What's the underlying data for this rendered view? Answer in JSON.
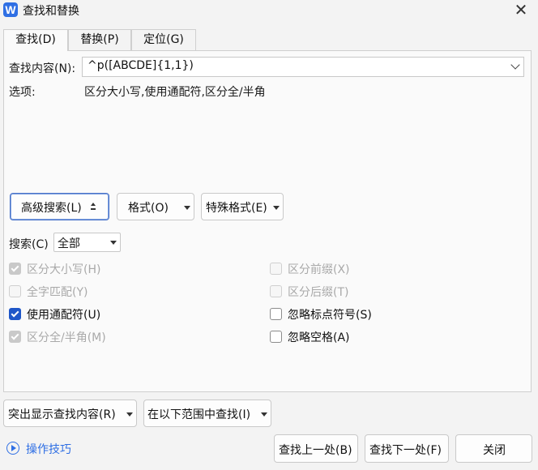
{
  "window": {
    "title": "查找和替换",
    "app_icon_letter": "W",
    "close_glyph": "✕"
  },
  "tabs": [
    {
      "label": "查找(D)",
      "active": true
    },
    {
      "label": "替换(P)",
      "active": false
    },
    {
      "label": "定位(G)",
      "active": false
    }
  ],
  "find": {
    "label": "查找内容(N):",
    "value": "^p([ABCDE]{1,1})"
  },
  "options": {
    "label": "选项:",
    "value": "区分大小写,使用通配符,区分全/半角"
  },
  "buttons": {
    "advanced": "高级搜索(L)",
    "format": "格式(O)",
    "special": "特殊格式(E)",
    "highlight": "突出显示查找内容(R)",
    "find_in": "在以下范围中查找(I)",
    "find_prev": "查找上一处(B)",
    "find_next": "查找下一处(F)",
    "close": "关闭"
  },
  "search_scope": {
    "label": "搜索(C)",
    "value": "全部"
  },
  "checkboxes": {
    "left": [
      {
        "label": "区分大小写(H)",
        "checked": true,
        "enabled": false
      },
      {
        "label": "全字匹配(Y)",
        "checked": false,
        "enabled": false
      },
      {
        "label": "使用通配符(U)",
        "checked": true,
        "enabled": true
      },
      {
        "label": "区分全/半角(M)",
        "checked": true,
        "enabled": false
      }
    ],
    "right": [
      {
        "label": "区分前缀(X)",
        "checked": false,
        "enabled": false
      },
      {
        "label": "区分后缀(T)",
        "checked": false,
        "enabled": false
      },
      {
        "label": "忽略标点符号(S)",
        "checked": false,
        "enabled": true
      },
      {
        "label": "忽略空格(A)",
        "checked": false,
        "enabled": true
      }
    ]
  },
  "tips": {
    "label": "操作技巧"
  },
  "colors": {
    "accent": "#2f6fe4",
    "checkbox_checked": "#1f57c8",
    "disabled_text": "#a9a9a9"
  }
}
